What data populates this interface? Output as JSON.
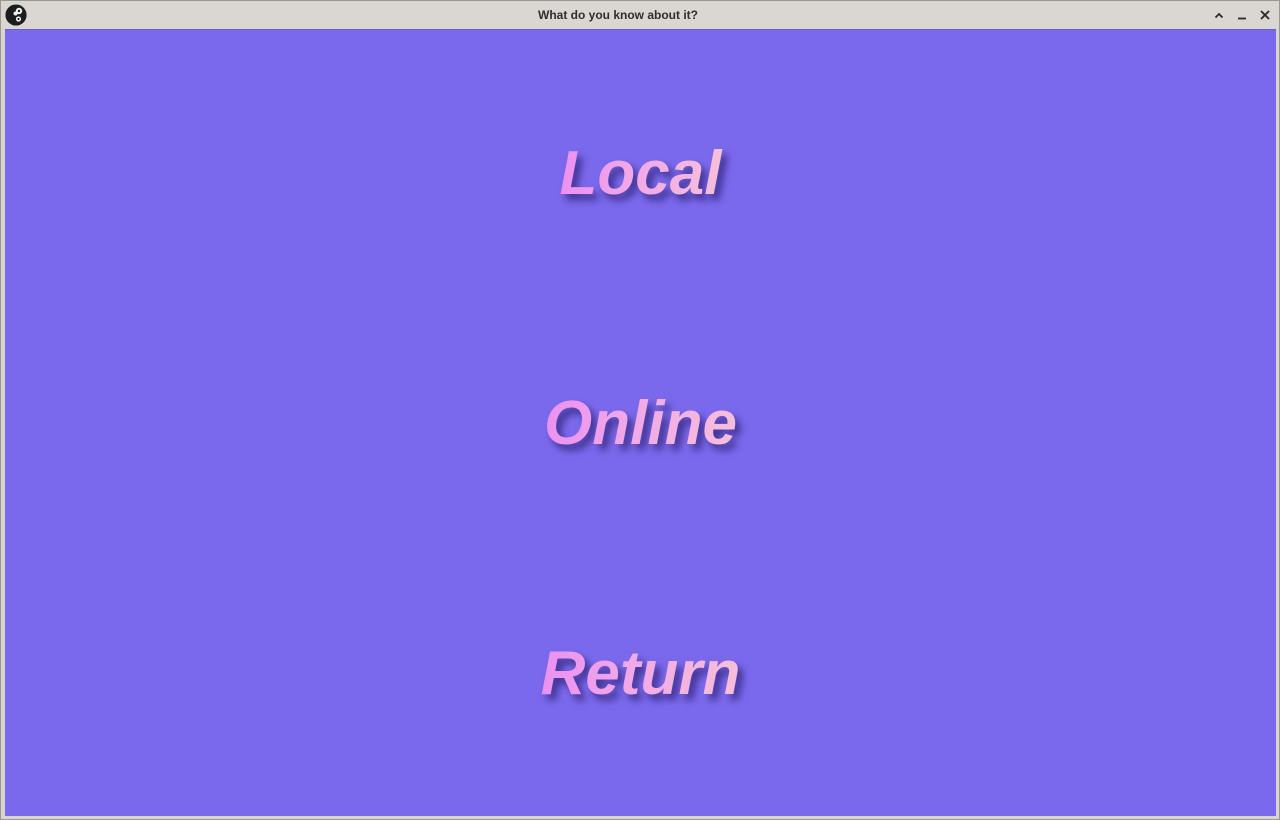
{
  "window": {
    "title": "What do you know about it?",
    "controls": [
      "maximize-icon",
      "minimize-icon",
      "close-icon"
    ]
  },
  "menu": {
    "items": [
      {
        "label": "Local"
      },
      {
        "label": "Online"
      },
      {
        "label": "Return"
      }
    ]
  },
  "colors": {
    "background": "#7b69ed",
    "titlebar": "#dad6d2",
    "text_gradient_start": "#ea8ef2",
    "text_gradient_end": "#f7c1d8"
  }
}
